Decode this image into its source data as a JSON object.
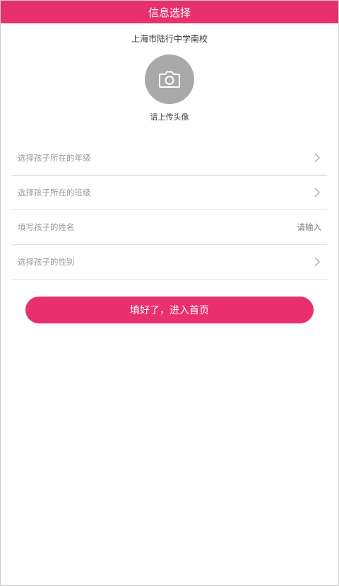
{
  "header": {
    "title": "信息选择"
  },
  "school": {
    "name": "上海市陆行中学南校"
  },
  "avatar": {
    "icon": "camera-icon",
    "label": "请上传头像"
  },
  "form": {
    "grade": {
      "label": "选择孩子所在的年级",
      "icon": "chevron-right-icon"
    },
    "class": {
      "label": "选择孩子所在的班级",
      "icon": "chevron-right-icon"
    },
    "name": {
      "label": "填写孩子的姓名",
      "placeholder": "请输入"
    },
    "gender": {
      "label": "选择孩子的性别",
      "icon": "chevron-right-icon"
    }
  },
  "submit": {
    "label": "填好了，进入首页"
  },
  "colors": {
    "brand": "#e8306e",
    "avatar_bg": "#a9a9a9"
  }
}
